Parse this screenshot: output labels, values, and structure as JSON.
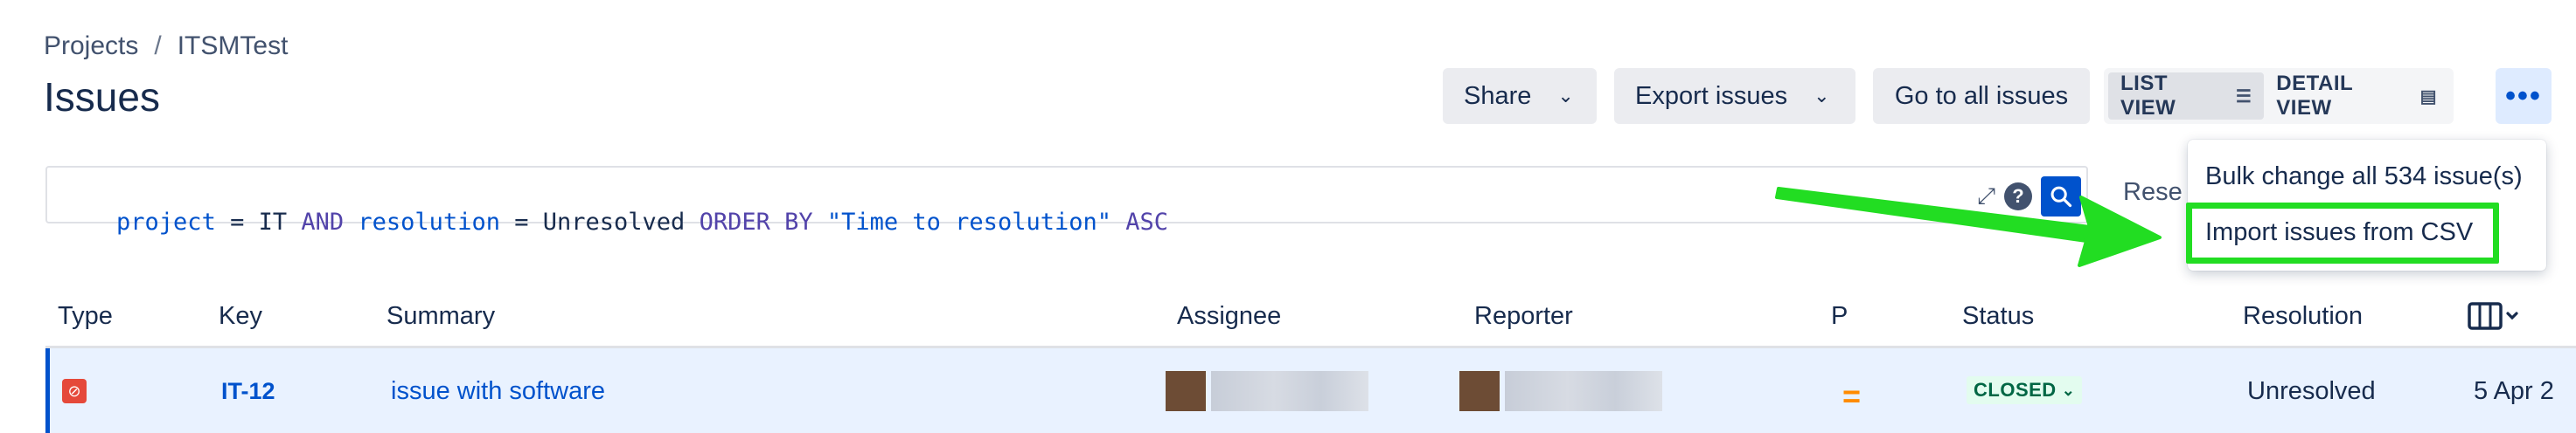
{
  "breadcrumb": {
    "projects": "Projects",
    "separator": "/",
    "project": "ITSMTest"
  },
  "page_title": "Issues",
  "toolbar": {
    "share_label": "Share",
    "export_label": "Export issues",
    "goto_all_label": "Go to all issues",
    "list_view_label": "LIST VIEW",
    "detail_view_label": "DETAIL VIEW",
    "more_label": "•••"
  },
  "jql": {
    "tokens": [
      {
        "text": "project",
        "kind": "field"
      },
      {
        "text": " = ",
        "kind": "op"
      },
      {
        "text": "IT",
        "kind": "val"
      },
      {
        "text": " AND ",
        "kind": "kw"
      },
      {
        "text": "resolution",
        "kind": "field"
      },
      {
        "text": " = ",
        "kind": "op"
      },
      {
        "text": "Unresolved",
        "kind": "val"
      },
      {
        "text": " ORDER BY ",
        "kind": "kw"
      },
      {
        "text": "\"Time to resolution\"",
        "kind": "str"
      },
      {
        "text": " ASC",
        "kind": "kw"
      }
    ]
  },
  "reset_label": "Rese",
  "dropdown": {
    "bulk_change": "Bulk change all 534 issue(s)",
    "import_csv": "Import issues from CSV"
  },
  "table": {
    "headers": {
      "type": "Type",
      "key": "Key",
      "summary": "Summary",
      "assignee": "Assignee",
      "reporter": "Reporter",
      "priority": "P",
      "status": "Status",
      "resolution": "Resolution"
    },
    "rows": [
      {
        "key": "IT-12",
        "summary": "issue with software",
        "priority": "=",
        "status": "CLOSED",
        "resolution": "Unresolved",
        "created": "5 Apr 2"
      }
    ]
  },
  "colors": {
    "accent": "#0052cc",
    "highlight": "#22dd22",
    "row_selected": "#e9f2ff",
    "priority_medium": "#ff8b00",
    "status_closed_bg": "#e3fcef",
    "status_closed_text": "#006644"
  },
  "icons": {
    "share_chevron": "chevron-down-icon",
    "export_chevron": "chevron-down-icon",
    "list_view": "list-icon",
    "detail_view": "detail-view-icon",
    "more": "more-horizontal-icon",
    "expand": "expand-icon",
    "help": "help-icon",
    "search": "search-icon",
    "type": "bug-icon",
    "columns": "columns-icon",
    "annotation": "green-arrow"
  }
}
